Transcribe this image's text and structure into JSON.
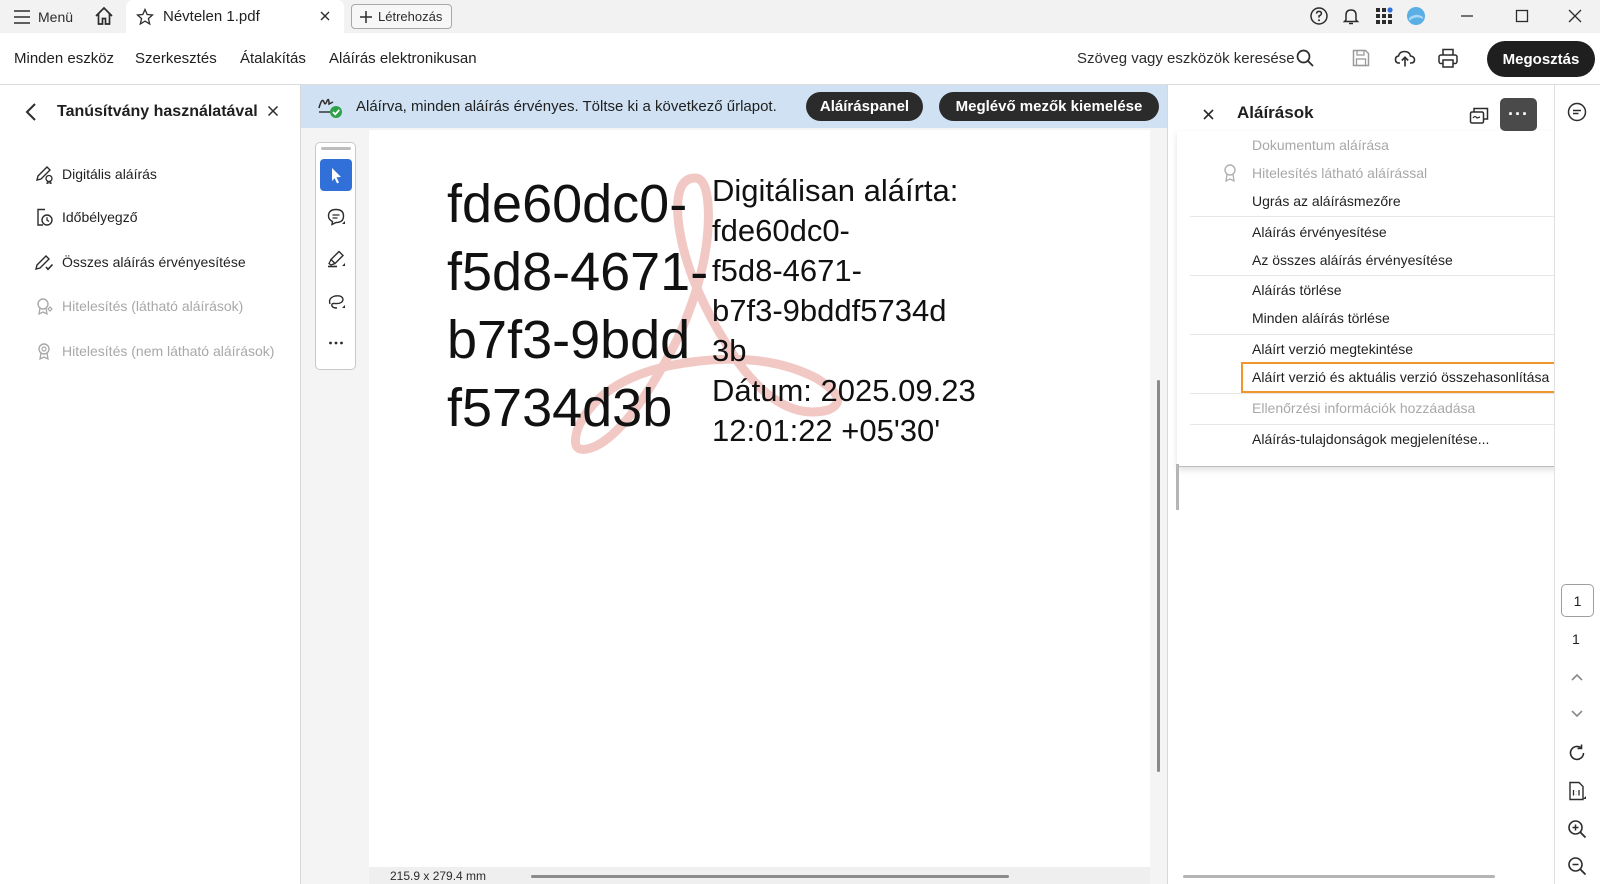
{
  "titlebar": {
    "menu_label": "Menü",
    "tab_title": "Névtelen 1.pdf",
    "create_label": "Létrehozás"
  },
  "toolbar": {
    "menus": [
      "Minden eszköz",
      "Szerkesztés",
      "Átalakítás",
      "Aláírás elektronikusan"
    ],
    "search_label": "Szöveg vagy eszközök keresése",
    "share_label": "Megosztás"
  },
  "left_panel": {
    "title": "Tanúsítvány használatával",
    "items": [
      {
        "label": "Digitális aláírás",
        "icon": "sign-cert-icon",
        "enabled": true
      },
      {
        "label": "Időbélyegző",
        "icon": "timestamp-icon",
        "enabled": true
      },
      {
        "label": "Összes aláírás érvényesítése",
        "icon": "validate-all-icon",
        "enabled": true
      },
      {
        "label": "Hitelesítés (látható aláírások)",
        "icon": "certify-visible-icon",
        "enabled": false
      },
      {
        "label": "Hitelesítés (nem látható aláírások)",
        "icon": "certify-invisible-icon",
        "enabled": false
      }
    ]
  },
  "banner": {
    "text": "Aláírva, minden aláírás érvényes.  Töltse ki a következő űrlapot.",
    "signature_panel_label": "Aláíráspanel",
    "highlight_fields_label": "Meglévő mezők kiemelése"
  },
  "document": {
    "signer_name_block": "fde60dc0-\nf5d8-4671-\nb7f3-9bdd\nf5734d3b",
    "details_block": "Digitálisan aláírta:\nfde60dc0-\nf5d8-4671-\nb7f3-9bddf5734d\n3b\nDátum: 2025.09.23\n12:01:22 +05'30'",
    "page_size": "215.9 x 279.4 mm"
  },
  "right_panel": {
    "title": "Aláírások",
    "more_label": "···",
    "menu": [
      {
        "label": "Dokumentum aláírása",
        "enabled": false
      },
      {
        "label": "Hitelesítés látható aláírással",
        "enabled": false
      },
      {
        "label": "Ugrás az aláírásmezőre",
        "enabled": true
      },
      {
        "label": "Aláírás érvényesítése",
        "enabled": true
      },
      {
        "label": "Az összes aláírás érvényesítése",
        "enabled": true
      },
      {
        "label": "Aláírás törlése",
        "enabled": true
      },
      {
        "label": "Minden aláírás törlése",
        "enabled": true
      },
      {
        "label": "Aláírt verzió megtekintése",
        "enabled": true
      },
      {
        "label": "Aláírt verzió és aktuális verzió összehasonlítása",
        "enabled": true,
        "highlighted": true
      },
      {
        "label": "Ellenőrzési információk hozzáadása",
        "enabled": false
      },
      {
        "label": "Aláírás-tulajdonságok megjelenítése...",
        "enabled": true
      }
    ]
  },
  "rail": {
    "current_page": "1",
    "total_pages": "1"
  },
  "colors": {
    "banner_bg": "#cfe1f3",
    "highlight_border": "#f0962c",
    "active_tool": "#3170d8",
    "primary_button": "#1f1f1f"
  }
}
